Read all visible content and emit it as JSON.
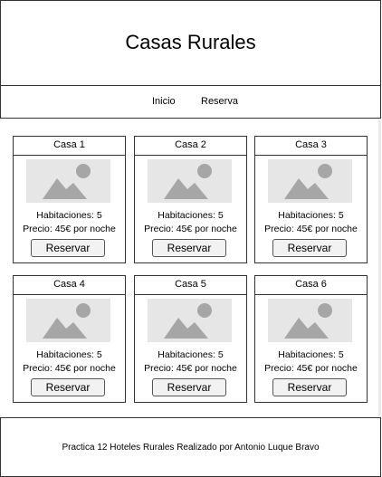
{
  "header": {
    "title": "Casas Rurales"
  },
  "nav": {
    "items": [
      {
        "label": "Inicio"
      },
      {
        "label": "Reserva"
      }
    ]
  },
  "cards": [
    {
      "name": "Casa 1",
      "rooms": "Habitaciones: 5",
      "price": "Precio: 45€ por noche",
      "button": "Reservar"
    },
    {
      "name": "Casa 2",
      "rooms": "Habitaciones: 5",
      "price": "Precio: 45€ por noche",
      "button": "Reservar"
    },
    {
      "name": "Casa 3",
      "rooms": "Habitaciones: 5",
      "price": "Precio: 45€ por noche",
      "button": "Reservar"
    },
    {
      "name": "Casa 4",
      "rooms": "Habitaciones: 5",
      "price": "Precio: 45€ por noche",
      "button": "Reservar"
    },
    {
      "name": "Casa 5",
      "rooms": "Habitaciones: 5",
      "price": "Precio: 45€ por noche",
      "button": "Reservar"
    },
    {
      "name": "Casa 6",
      "rooms": "Habitaciones: 5",
      "price": "Precio: 45€ por noche",
      "button": "Reservar"
    }
  ],
  "footer": {
    "text": "Practica 12 Hoteles Rurales Realizado por Antonio Luque Bravo"
  },
  "icons": {
    "card_image": "image-placeholder-icon"
  },
  "colors": {
    "placeholder_bg": "#e6e6e6",
    "placeholder_fg": "#a6a6a6",
    "button_bg": "#f2f2f2",
    "border": "#333333"
  }
}
